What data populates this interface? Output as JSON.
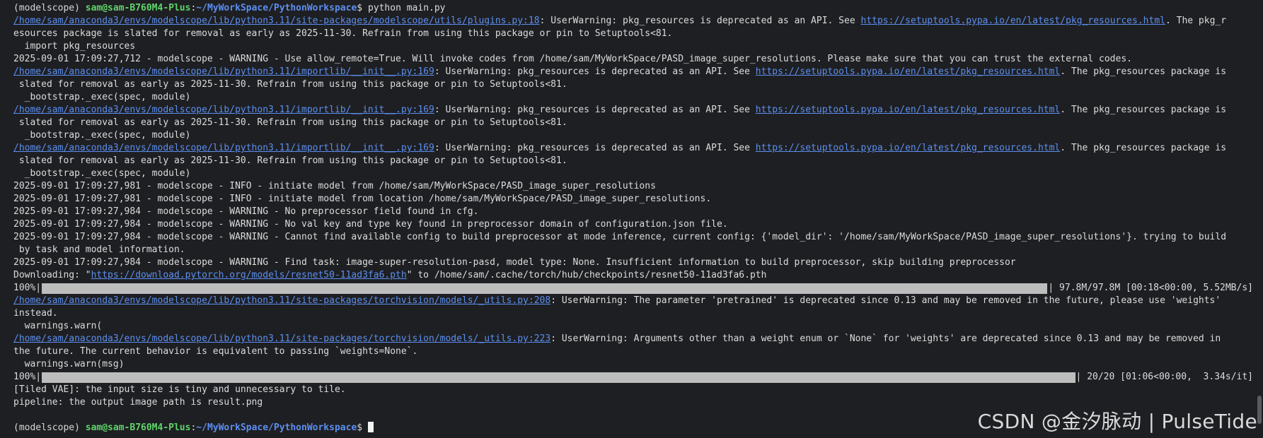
{
  "prompt_top": {
    "env": "(modelscope) ",
    "user": "sam@sam-B760M4-Plus",
    "colon": ":",
    "path": "~/MyWorkSpace/PythonWorkspace",
    "dollar": "$ ",
    "command": "python main.py"
  },
  "lines": {
    "l1_link": "/home/sam/anaconda3/envs/modelscope/lib/python3.11/site-packages/modelscope/utils/plugins.py:18",
    "l1_mid": ": UserWarning: pkg_resources is deprecated as an API. See ",
    "l1_url": "https://setuptools.pypa.io/en/latest/pkg_resources.html",
    "l1_end": ". The pkg_r",
    "l2": "esources package is slated for removal as early as 2025-11-30. Refrain from using this package or pin to Setuptools<81.",
    "l3": "  import pkg_resources",
    "l4": "2025-09-01 17:09:27,712 - modelscope - WARNING - Use allow_remote=True. Will invoke codes from /home/sam/MyWorkSpace/PASD_image_super_resolutions. Please make sure that you can trust the external codes.",
    "init_link": "/home/sam/anaconda3/envs/modelscope/lib/python3.11/importlib/__init__.py:169",
    "init_mid": ": UserWarning: pkg_resources is deprecated as an API. See ",
    "init_url": "https://setuptools.pypa.io/en/latest/pkg_resources.html",
    "init_end": ". The pkg_resources package is",
    "init_cont": " slated for removal as early as 2025-11-30. Refrain from using this package or pin to Setuptools<81.",
    "bootstrap": "  _bootstrap._exec(spec, module)",
    "info1": "2025-09-01 17:09:27,981 - modelscope - INFO - initiate model from /home/sam/MyWorkSpace/PASD_image_super_resolutions",
    "info2": "2025-09-01 17:09:27,981 - modelscope - INFO - initiate model from location /home/sam/MyWorkSpace/PASD_image_super_resolutions.",
    "warn1": "2025-09-01 17:09:27,984 - modelscope - WARNING - No preprocessor field found in cfg.",
    "warn2": "2025-09-01 17:09:27,984 - modelscope - WARNING - No val key and type key found in preprocessor domain of configuration.json file.",
    "warn3": "2025-09-01 17:09:27,984 - modelscope - WARNING - Cannot find available config to build preprocessor at mode inference, current config: {'model_dir': '/home/sam/MyWorkSpace/PASD_image_super_resolutions'}. trying to build",
    "warn3_cont": " by task and model information.",
    "warn4": "2025-09-01 17:09:27,984 - modelscope - WARNING - Find task: image-super-resolution-pasd, model type: None. Insufficient information to build preprocessor, skip building preprocessor",
    "dl_pre": "Downloading: \"",
    "dl_url": "https://download.pytorch.org/models/resnet50-11ad3fa6.pth",
    "dl_post": "\" to /home/sam/.cache/torch/hub/checkpoints/resnet50-11ad3fa6.pth",
    "tv1_link": "/home/sam/anaconda3/envs/modelscope/lib/python3.11/site-packages/torchvision/models/_utils.py:208",
    "tv1_mid": ": UserWarning: The parameter 'pretrained' is deprecated since 0.13 and may be removed in the future, please use 'weights'",
    "tv1_cont": "instead.",
    "tv1_warn": "  warnings.warn(",
    "tv2_link": "/home/sam/anaconda3/envs/modelscope/lib/python3.11/site-packages/torchvision/models/_utils.py:223",
    "tv2_mid": ": UserWarning: Arguments other than a weight enum or `None` for 'weights' are deprecated since 0.13 and may be removed in",
    "tv2_cont": "the future. The current behavior is equivalent to passing `weights=None`.",
    "tv2_warn": "  warnings.warn(msg)",
    "tiled": "[Tiled VAE]: the input size is tiny and unnecessary to tile.",
    "pipeline": "pipeline: the output image path is result.png"
  },
  "progress": [
    {
      "label": "100%|",
      "fraction": 1.0,
      "stats": "| 97.8M/97.8M [00:18<00:00, 5.52MB/s]"
    },
    {
      "label": "100%|",
      "fraction": 1.0,
      "stats": "| 20/20 [01:06<00:00,  3.34s/it]"
    }
  ],
  "prompt_bottom": {
    "env": "(modelscope) ",
    "user": "sam@sam-B760M4-Plus",
    "colon": ":",
    "path": "~/MyWorkSpace/PythonWorkspace",
    "dollar": "$ "
  },
  "watermark": "CSDN @金汐脉动 | PulseTide",
  "colors": {
    "background": "#1e1f22",
    "text": "#dcdcdc",
    "prompt_user": "#5fd46a",
    "prompt_path": "#5c8ff0",
    "link": "#5c8ff0",
    "progress_fill": "#bdbdbd"
  }
}
